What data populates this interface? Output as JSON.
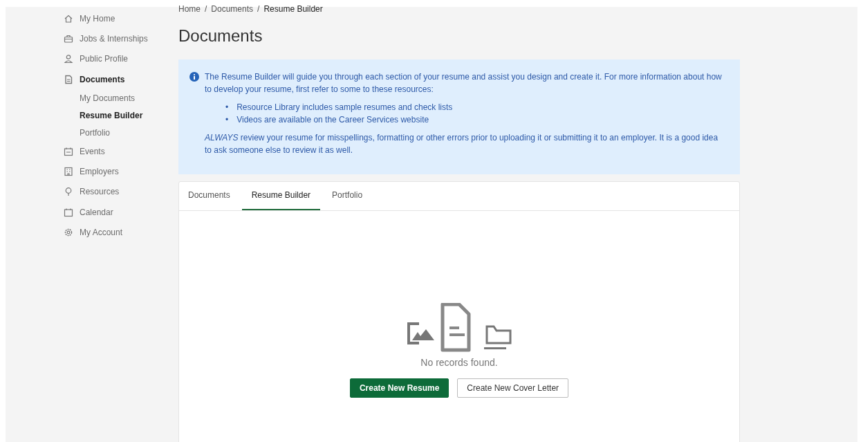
{
  "sidebar": {
    "items": [
      {
        "label": "My Home",
        "selected": false
      },
      {
        "label": "Jobs & Internships",
        "selected": false
      },
      {
        "label": "Public Profile",
        "selected": false
      },
      {
        "label": "Documents",
        "selected": true,
        "children": [
          {
            "label": "My Documents",
            "selected": false
          },
          {
            "label": "Resume Builder",
            "selected": true
          },
          {
            "label": "Portfolio",
            "selected": false
          }
        ]
      },
      {
        "label": "Events",
        "selected": false
      },
      {
        "label": "Employers",
        "selected": false
      },
      {
        "label": "Resources",
        "selected": false
      },
      {
        "label": "Calendar",
        "selected": false
      },
      {
        "label": "My Account",
        "selected": false
      }
    ]
  },
  "breadcrumb": [
    "Home",
    "Documents",
    "Resume Builder"
  ],
  "breadcrumb_separators": [
    "/",
    "/"
  ],
  "page_title": "Documents",
  "info": {
    "intro": "The Resume Builder will guide you through each section of your resume and assist you design and create it.  For more information about how to develop your resume, first refer to some to these resources:",
    "bullets": [
      {
        "marker": "•",
        "text": "Resource Library includes sample resumes and check lists"
      },
      {
        "marker": "•",
        "text": "Videos are available on the Career Services website"
      }
    ],
    "note": "*ALWAYS* review your resume for misspellings, formatting or other errors prior to uploading it or submitting it to an employer.   It is a good idea to ask someone else to review it as well."
  },
  "tabs": [
    {
      "label": "Documents",
      "selected": false
    },
    {
      "label": "Resume Builder",
      "selected": true
    },
    {
      "label": "Portfolio",
      "selected": false
    }
  ],
  "empty_state": {
    "message": "No records found."
  },
  "buttons": [
    {
      "label": "Create New Resume",
      "kind": "primary"
    },
    {
      "label": "Create New Cover Letter",
      "kind": "secondary"
    }
  ]
}
